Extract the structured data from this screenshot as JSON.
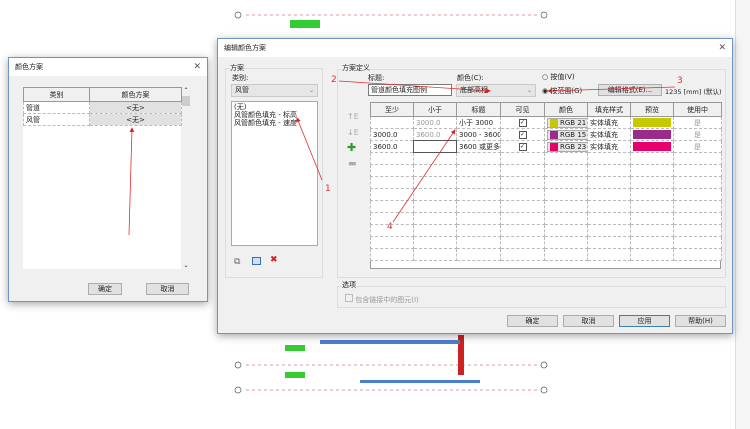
{
  "left_dialog": {
    "title": "颜色方案",
    "columns": [
      "类别",
      "颜色方案"
    ],
    "rows": [
      {
        "category": "管道",
        "scheme": "<无>"
      },
      {
        "category": "风管",
        "scheme": "<无>"
      }
    ],
    "ok": "确定",
    "cancel": "取消"
  },
  "main_dialog": {
    "title": "编辑颜色方案",
    "scheme_group": "方案",
    "category_label": "类别:",
    "category_value": "风管",
    "schemes": [
      "(无)",
      "风管颜色填充 - 标高",
      "风管颜色填充 - 速度"
    ],
    "definition_group": "方案定义",
    "title_label": "标题:",
    "title_value": "管道颜色填充图例",
    "color_label": "颜色(C):",
    "color_value": "底部高程",
    "by_value": "按值(V)",
    "by_range": "按范围(G)",
    "edit_format": "编辑格式(E)...",
    "format_sample": "1235 [mm] (默认)",
    "columns": [
      "至少",
      "小于",
      "标题",
      "可见",
      "颜色",
      "填充样式",
      "预览",
      "使用中"
    ],
    "rows": [
      {
        "at_least": "",
        "less_than": "3000.0",
        "caption": "小于 3000",
        "visible": true,
        "color": "RGB 21",
        "swatch": "#c8c800",
        "fill": "实体填充",
        "in_use": "是"
      },
      {
        "at_least": "3000.0",
        "less_than": "3600.0",
        "caption": "3000 - 3600",
        "visible": true,
        "color": "RGB 15",
        "swatch": "#9b2a8c",
        "fill": "实体填充",
        "in_use": "是"
      },
      {
        "at_least": "3600.0",
        "less_than": "",
        "caption": "3600 或更多",
        "visible": true,
        "color": "RGB 23",
        "swatch": "#e8006a",
        "fill": "实体填充",
        "in_use": "是"
      }
    ],
    "options_group": "选项",
    "include_linked": "包含链接中的图元(I)",
    "ok": "确定",
    "cancel": "取消",
    "apply": "应用",
    "help": "帮助(H)"
  },
  "annotations": [
    "1",
    "2",
    "3",
    "4"
  ]
}
